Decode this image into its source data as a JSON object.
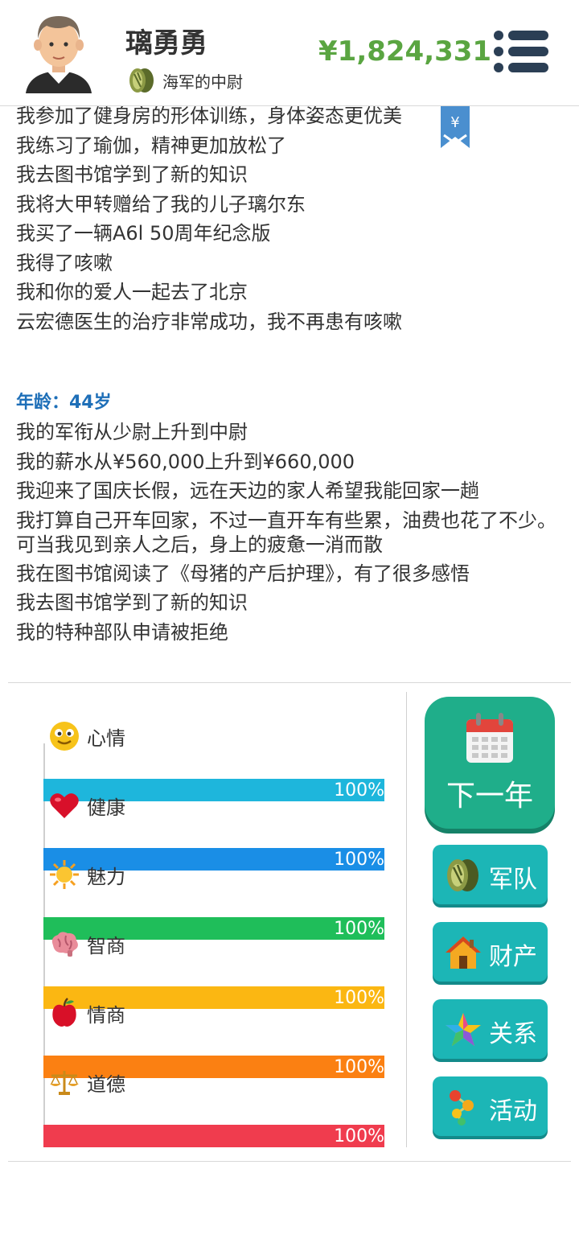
{
  "header": {
    "player_name": "璃勇勇",
    "rank": "海军的中尉",
    "money": "¥1,824,331"
  },
  "log": {
    "previous_lines": [
      "我参加了健身房的形体训练，身体姿态更优美",
      "我练习了瑜伽，精神更加放松了",
      "我去图书馆学到了新的知识",
      "我将大甲转赠给了我的儿子璃尔东",
      "我买了一辆A6l 50周年纪念版",
      "我得了咳嗽",
      "我和你的爱人一起去了北京",
      "云宏德医生的治疗非常成功，我不再患有咳嗽"
    ],
    "age_label": "年龄：44岁",
    "current_lines": [
      "我的军衔从少尉上升到中尉",
      "我的薪水从¥560,000上升到¥660,000",
      "我迎来了国庆长假，远在天边的家人希望我能回家一趟",
      "我打算自己开车回家，不过一直开车有些累，油费也花了不少。可当我见到亲人之后，身上的疲惫一消而散",
      "我在图书馆阅读了《母猪的产后护理》，有了很多感悟",
      "我去图书馆学到了新的知识",
      "我的特种部队申请被拒绝"
    ],
    "bookmark_symbol": "¥"
  },
  "stats": [
    {
      "label": "心情",
      "value": "100%",
      "fraction": 1.0,
      "color": "#1eb6dc",
      "icon": "smiley-icon"
    },
    {
      "label": "健康",
      "value": "100%",
      "fraction": 1.0,
      "color": "#1a8ee6",
      "icon": "heart-icon"
    },
    {
      "label": "魅力",
      "value": "100%",
      "fraction": 1.0,
      "color": "#1fbe5a",
      "icon": "sun-icon"
    },
    {
      "label": "智商",
      "value": "100%",
      "fraction": 1.0,
      "color": "#fbb712",
      "icon": "brain-icon"
    },
    {
      "label": "情商",
      "value": "100%",
      "fraction": 1.0,
      "color": "#fb8012",
      "icon": "apple-icon"
    },
    {
      "label": "道德",
      "value": "100%",
      "fraction": 1.0,
      "color": "#f03c4e",
      "icon": "scale-icon"
    }
  ],
  "buttons": {
    "next_year": "下一年",
    "army": "军队",
    "assets": "财产",
    "relations": "关系",
    "activities": "活动"
  }
}
